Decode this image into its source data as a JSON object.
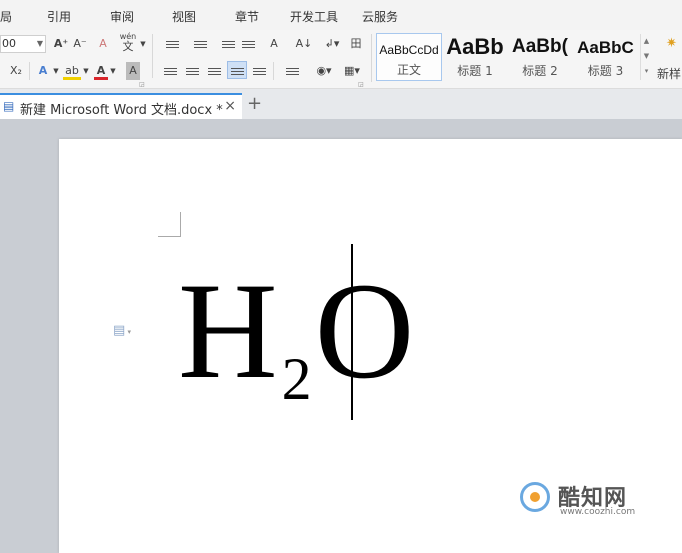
{
  "menu": {
    "items": [
      "布局",
      "引用",
      "审阅",
      "视图",
      "章节",
      "开发工具",
      "云服务"
    ],
    "first_visible": "局"
  },
  "ribbon": {
    "font_size_value": "00",
    "grow_font": "A⁺",
    "shrink_font": "A⁻",
    "clear_format": "A",
    "pinyin_top": "wén",
    "pinyin_bottom": "文",
    "subscript": "X₂",
    "text_effect": "A",
    "highlight": "ab",
    "font_color": "A",
    "char_shading": "A",
    "text_direction": "A",
    "sort": "A↓",
    "border": "田",
    "highlight_color": "#f0d000",
    "font_color_bar": "#d9262c",
    "style_launcher": "新样",
    "styles": [
      {
        "sample": "AaBbCcDd",
        "name": "正文",
        "selected": true
      },
      {
        "sample": "AaBb",
        "name": "标题 1",
        "selected": false
      },
      {
        "sample": "AaBb(",
        "name": "标题 2",
        "selected": false
      },
      {
        "sample": "AaBbC",
        "name": "标题 3",
        "selected": false
      }
    ]
  },
  "tabs": {
    "document_title": "新建 Microsoft Word 文档.docx *",
    "close_glyph": "×",
    "new_tab_glyph": "+"
  },
  "document": {
    "formula_base": "H",
    "formula_sub": "2",
    "formula_end": "O"
  },
  "watermark": {
    "name": "酷知网",
    "url": "www.coozhi.com"
  },
  "colors": {
    "tab_accent": "#3b8ee0",
    "workspace": "#c9cdd3"
  }
}
